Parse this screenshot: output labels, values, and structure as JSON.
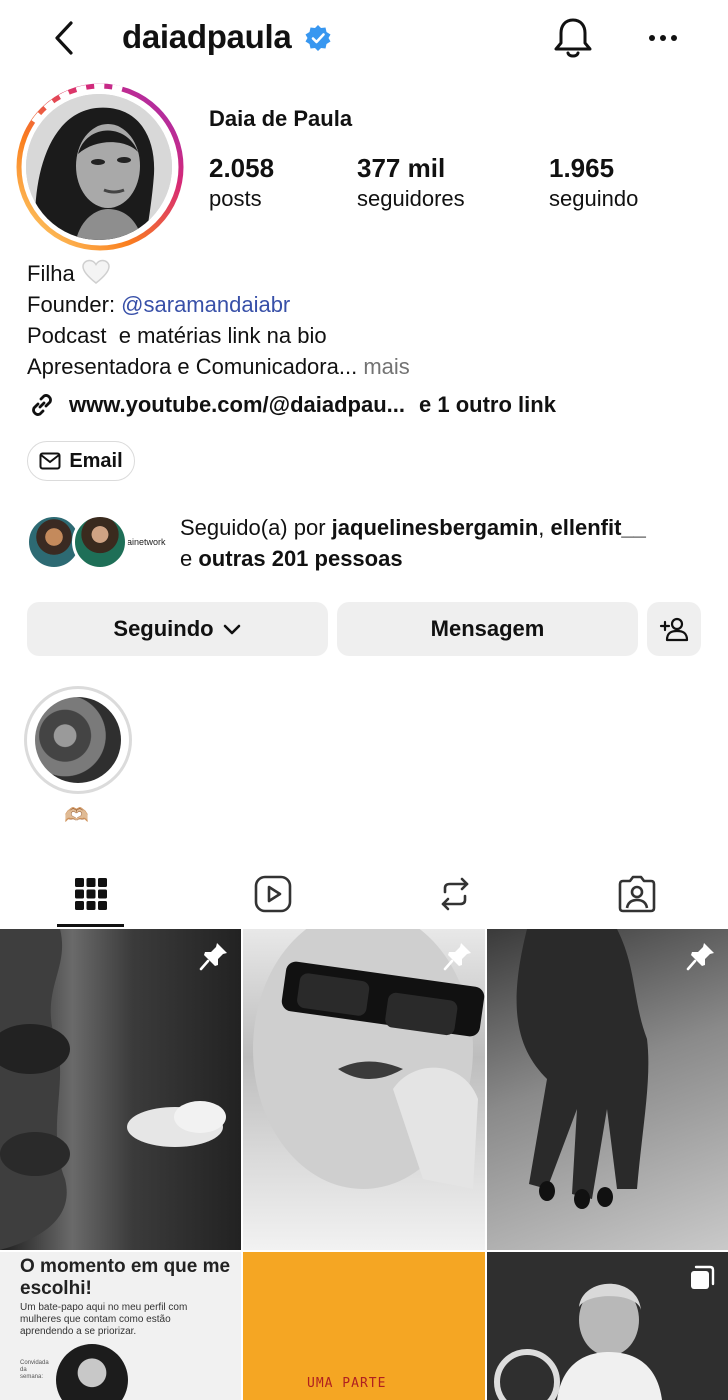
{
  "header": {
    "username": "daiadpaula",
    "verified": true
  },
  "profile": {
    "display_name": "Daia de Paula",
    "stats": {
      "posts": {
        "value": "2.058",
        "label": "posts"
      },
      "followers": {
        "value": "377 mil",
        "label": "seguidores"
      },
      "following": {
        "value": "1.965",
        "label": "seguindo"
      }
    },
    "bio": {
      "line1": "Filha",
      "line1_icon": "white-heart-icon",
      "line2_prefix": "Founder: ",
      "line2_mention": "@saramandaiabr",
      "line3": "Podcast  e matérias link na bio",
      "line4": "Apresentadora e Comunicadora...",
      "more": " mais"
    },
    "link": {
      "url": "www.youtube.com/@daiadpau...",
      "other": "e 1 outro link"
    },
    "email_label": "Email"
  },
  "followed_by": {
    "tag": "ainetwork",
    "prefix": "Seguido(a) por ",
    "user1": "jaquelinesbergamin",
    "separator": ", ",
    "user2": "ellenfit__",
    "line2_prefix": "e ",
    "others": "outras 201 pessoas"
  },
  "actions": {
    "following_label": "Seguindo",
    "message_label": "Mensagem"
  },
  "highlights": [
    {
      "label": "🫶🏼"
    }
  ],
  "tabs": [
    {
      "name": "grid-icon",
      "active": true
    },
    {
      "name": "reels-icon",
      "active": false
    },
    {
      "name": "reposts-icon",
      "active": false
    },
    {
      "name": "tagged-icon",
      "active": false
    }
  ],
  "posts": {
    "p4_title": "O momento em que me escolhi!",
    "p4_sub": "Um bate-papo aqui no meu perfil com mulheres que contam como estão aprendendo a se priorizar.",
    "p4_guest": "Convidada da semana:",
    "p5_text": "UMA PARTE"
  },
  "colors": {
    "verified": "#3897f0",
    "mention": "#3850a8",
    "button_bg": "#efefef",
    "story_gradient": [
      "#feda75",
      "#fa7e1e",
      "#d62976",
      "#962fbf"
    ]
  }
}
